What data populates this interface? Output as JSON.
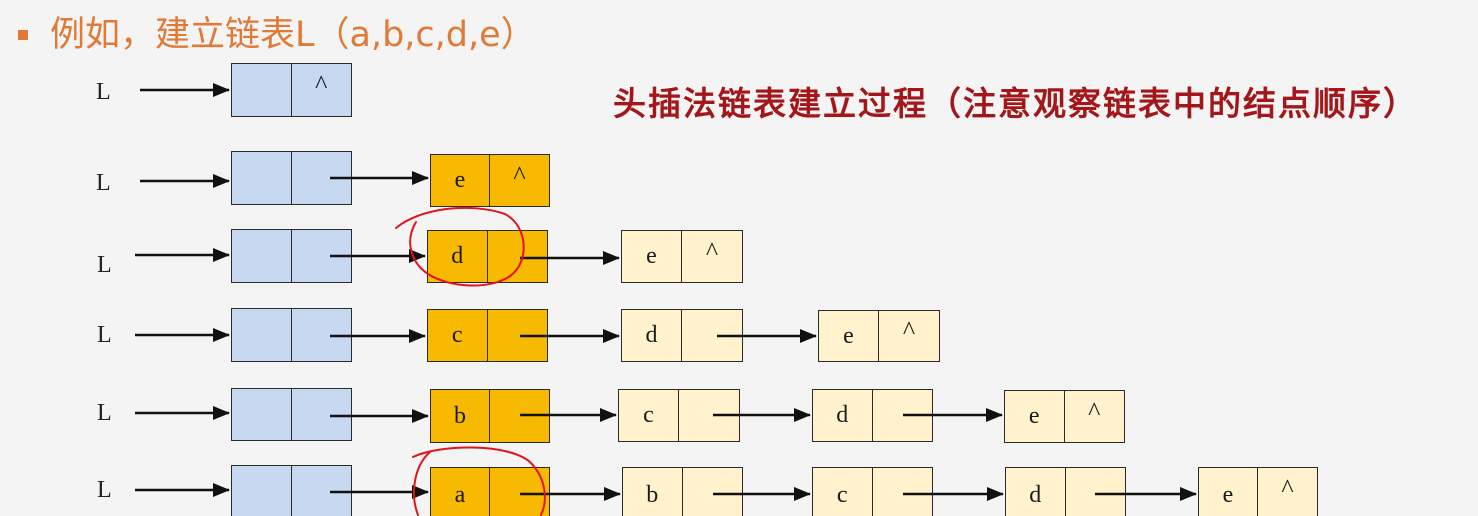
{
  "header": {
    "text": "例如，建立链表L（a,b,c,d,e）",
    "bullet_icon": "square-bullet-icon"
  },
  "title": "头插法链表建立过程（注意观察链表中的结点顺序）",
  "colors": {
    "background": "#F4F4F4",
    "header_text": "#E07A36",
    "title_text": "#A3171B",
    "head_node": "#C6D9F0",
    "new_node": "#F7BA00",
    "existing_node": "#FFF2CC",
    "annotation_circle": "#E0141C",
    "arrow": "#111111"
  },
  "rows": [
    {
      "label": "L",
      "head": {
        "next": "^"
      },
      "nodes": []
    },
    {
      "label": "L",
      "nodes": [
        {
          "data": "e",
          "next": "^",
          "new": true
        }
      ]
    },
    {
      "label": "L",
      "nodes": [
        {
          "data": "d",
          "new": true,
          "circled": true
        },
        {
          "data": "e",
          "next": "^"
        }
      ]
    },
    {
      "label": "L",
      "nodes": [
        {
          "data": "c",
          "new": true
        },
        {
          "data": "d"
        },
        {
          "data": "e",
          "next": "^"
        }
      ]
    },
    {
      "label": "L",
      "nodes": [
        {
          "data": "b",
          "new": true
        },
        {
          "data": "c"
        },
        {
          "data": "d"
        },
        {
          "data": "e",
          "next": "^"
        }
      ]
    },
    {
      "label": "L",
      "nodes": [
        {
          "data": "a",
          "new": true,
          "circled": true
        },
        {
          "data": "b"
        },
        {
          "data": "c"
        },
        {
          "data": "d"
        },
        {
          "data": "e",
          "next": "^"
        }
      ]
    }
  ]
}
